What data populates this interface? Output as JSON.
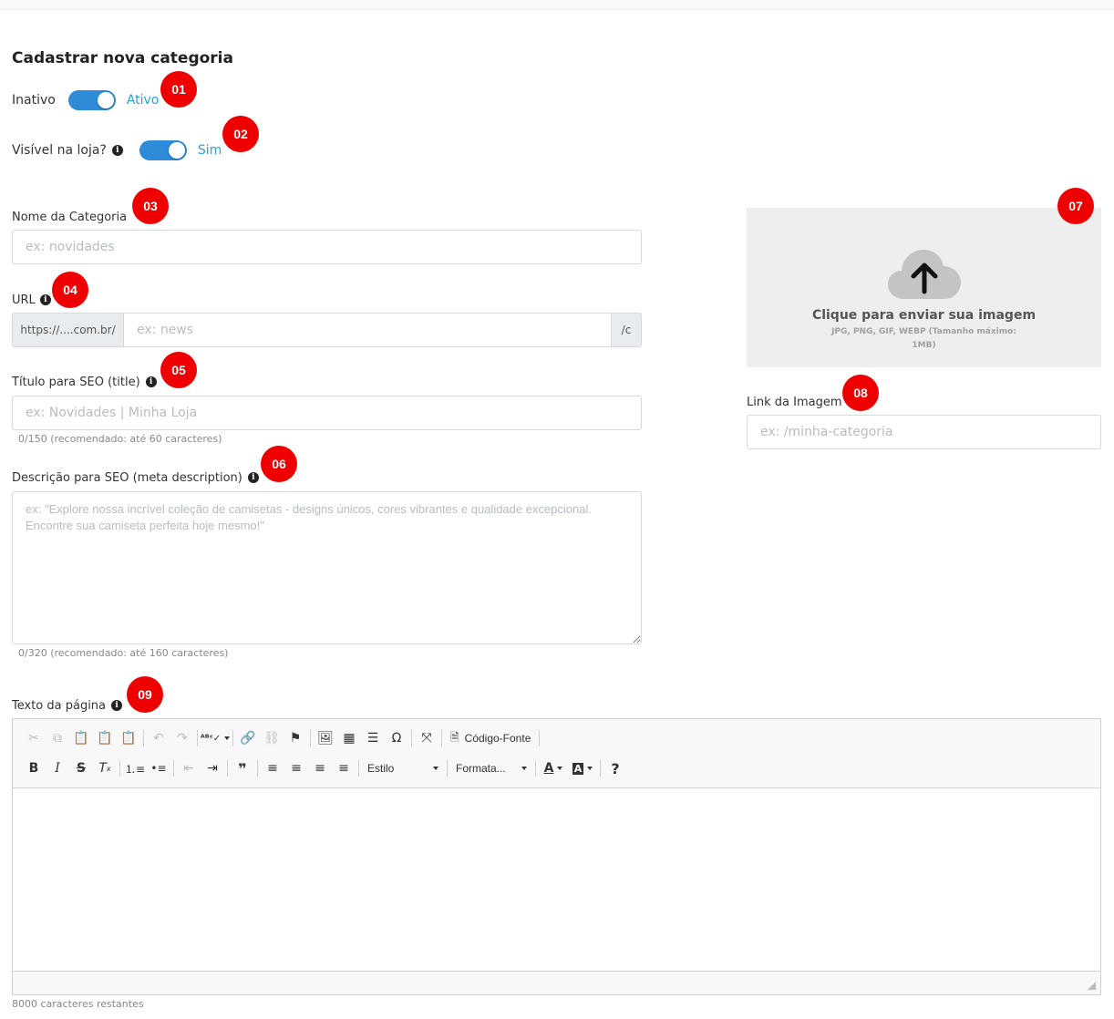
{
  "page": {
    "title": "Cadastrar nova categoria"
  },
  "status": {
    "label_off": "Inativo",
    "label_on": "Ativo",
    "badge": "01"
  },
  "visibility": {
    "label": "Visível na loja?",
    "label_on": "Sim",
    "badge": "02"
  },
  "name_field": {
    "label": "Nome da Categoria",
    "placeholder": "ex: novidades",
    "badge": "03"
  },
  "url_field": {
    "label": "URL",
    "prefix": "https://....com.br/",
    "placeholder": "ex: news",
    "suffix": "/c",
    "badge": "04"
  },
  "seo_title": {
    "label": "Título para SEO (title)",
    "placeholder": "ex: Novidades | Minha Loja",
    "counter": "0/150 (recomendado: até 60 caracteres)",
    "badge": "05"
  },
  "seo_description": {
    "label": "Descrição para SEO (meta description)",
    "placeholder": "ex: \"Explore nossa incrível coleção de camisetas - designs únicos, cores vibrantes e qualidade excepcional. Encontre sua camiseta perfeita hoje mesmo!\"",
    "counter": "0/320 (recomendado: até 160 caracteres)",
    "badge": "06"
  },
  "image_upload": {
    "title": "Clique para enviar sua imagem",
    "subtitle": "JPG, PNG, GIF, WEBP (Tamanho máximo: 1MB)",
    "icon": "cloud-upload-icon",
    "badge": "07"
  },
  "image_link": {
    "label": "Link da Imagem",
    "placeholder": "ex: /minha-categoria",
    "badge": "08"
  },
  "page_text": {
    "label": "Texto da página",
    "badge": "09",
    "source_label": "Código-Fonte",
    "style_combo": "Estilo",
    "format_combo": "Formata...",
    "remaining": "8000 caracteres restantes"
  },
  "colors": {
    "accent": "#2e8bd8",
    "badge": "#ee0000",
    "toggle_label": "#2aa0d6"
  }
}
